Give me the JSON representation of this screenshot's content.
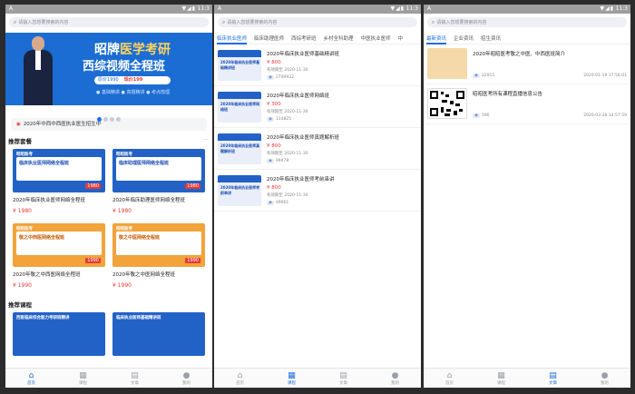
{
  "status": {
    "time": "11:3",
    "left": "A"
  },
  "search": {
    "placeholder": "请输入您想要搜索的内容"
  },
  "tabbar": [
    {
      "label": "首页",
      "icon": "home-icon"
    },
    {
      "label": "课程",
      "icon": "course-icon"
    },
    {
      "label": "文章",
      "icon": "article-icon"
    },
    {
      "label": "我的",
      "icon": "user-icon"
    }
  ],
  "home": {
    "banner": {
      "title_a": "昭牌",
      "title_b": "医学考研",
      "subtitle": "西综视频全程班",
      "price_orig": "原价1990",
      "price_now": "现价199",
      "tags": "● 基础精讲  ● 真题精讲  ● 考点梳理"
    },
    "notice": "2020年中西中西医执业医生招生中",
    "section1": {
      "title": "推荐套餐",
      "more": "···"
    },
    "packages": [
      {
        "title": "2020年临床执业医师网络全程班",
        "price": "¥ 1980",
        "thumb_text": "临床执业医师网络全程班",
        "thumb_top": "昭昭医考",
        "tag": "1980",
        "color": "blue"
      },
      {
        "title": "2020年临床助理医师网络全程班",
        "price": "¥ 1980",
        "thumb_text": "临床助理医师网络全程班",
        "thumb_top": "昭昭医考",
        "tag": "1980",
        "color": "blue"
      },
      {
        "title": "2020年敬之中西医网络全程班",
        "price": "¥ 1990",
        "thumb_text": "敬之中西医网络全程班",
        "thumb_top": "昭昭医考",
        "tag": "1990",
        "color": "orange"
      },
      {
        "title": "2020年敬之中医网络全程班",
        "price": "¥ 1990",
        "thumb_text": "敬之中医网络全程班",
        "thumb_top": "昭昭医考",
        "tag": "1990",
        "color": "orange"
      }
    ],
    "section2": {
      "title": "推荐课程"
    },
    "course_teasers": [
      {
        "text": "西医临床综合能力考研班精讲"
      },
      {
        "text": "临床执业医师基础精讲班"
      }
    ]
  },
  "courses": {
    "tabs": [
      "临床执业医师",
      "临床助理医师",
      "西综考研班",
      "乡村全科助理",
      "中医执业医师",
      "中"
    ],
    "items": [
      {
        "title": "2020年临床执业医师基础精讲班",
        "price": "¥ 800",
        "date": "有效期至 2020-11-30",
        "views": "2709932"
      },
      {
        "title": "2020年临床执业医师网络班",
        "price": "¥ 300",
        "date": "有效期至 2020-11-30",
        "views": "114825"
      },
      {
        "title": "2020年临床执业医师真题解析班",
        "price": "¥ 800",
        "date": "有效期至 2020-11-30",
        "views": "99478"
      },
      {
        "title": "2020年临床执业医师考前串讲",
        "price": "¥ 800",
        "date": "有效期至 2020-11-30",
        "views": "49661"
      }
    ]
  },
  "articles": {
    "tabs": [
      "最新资讯",
      "企业资讯",
      "招生资讯"
    ],
    "items": [
      {
        "title": "2020年昭昭医考敬之中医、中西医班简介",
        "views": "22915",
        "date": "2020-01-19 17:56:01"
      },
      {
        "title": "昭昭医考所有课程直播信息公告",
        "views": "596",
        "date": "2020-03-28 14:57:59"
      }
    ]
  }
}
